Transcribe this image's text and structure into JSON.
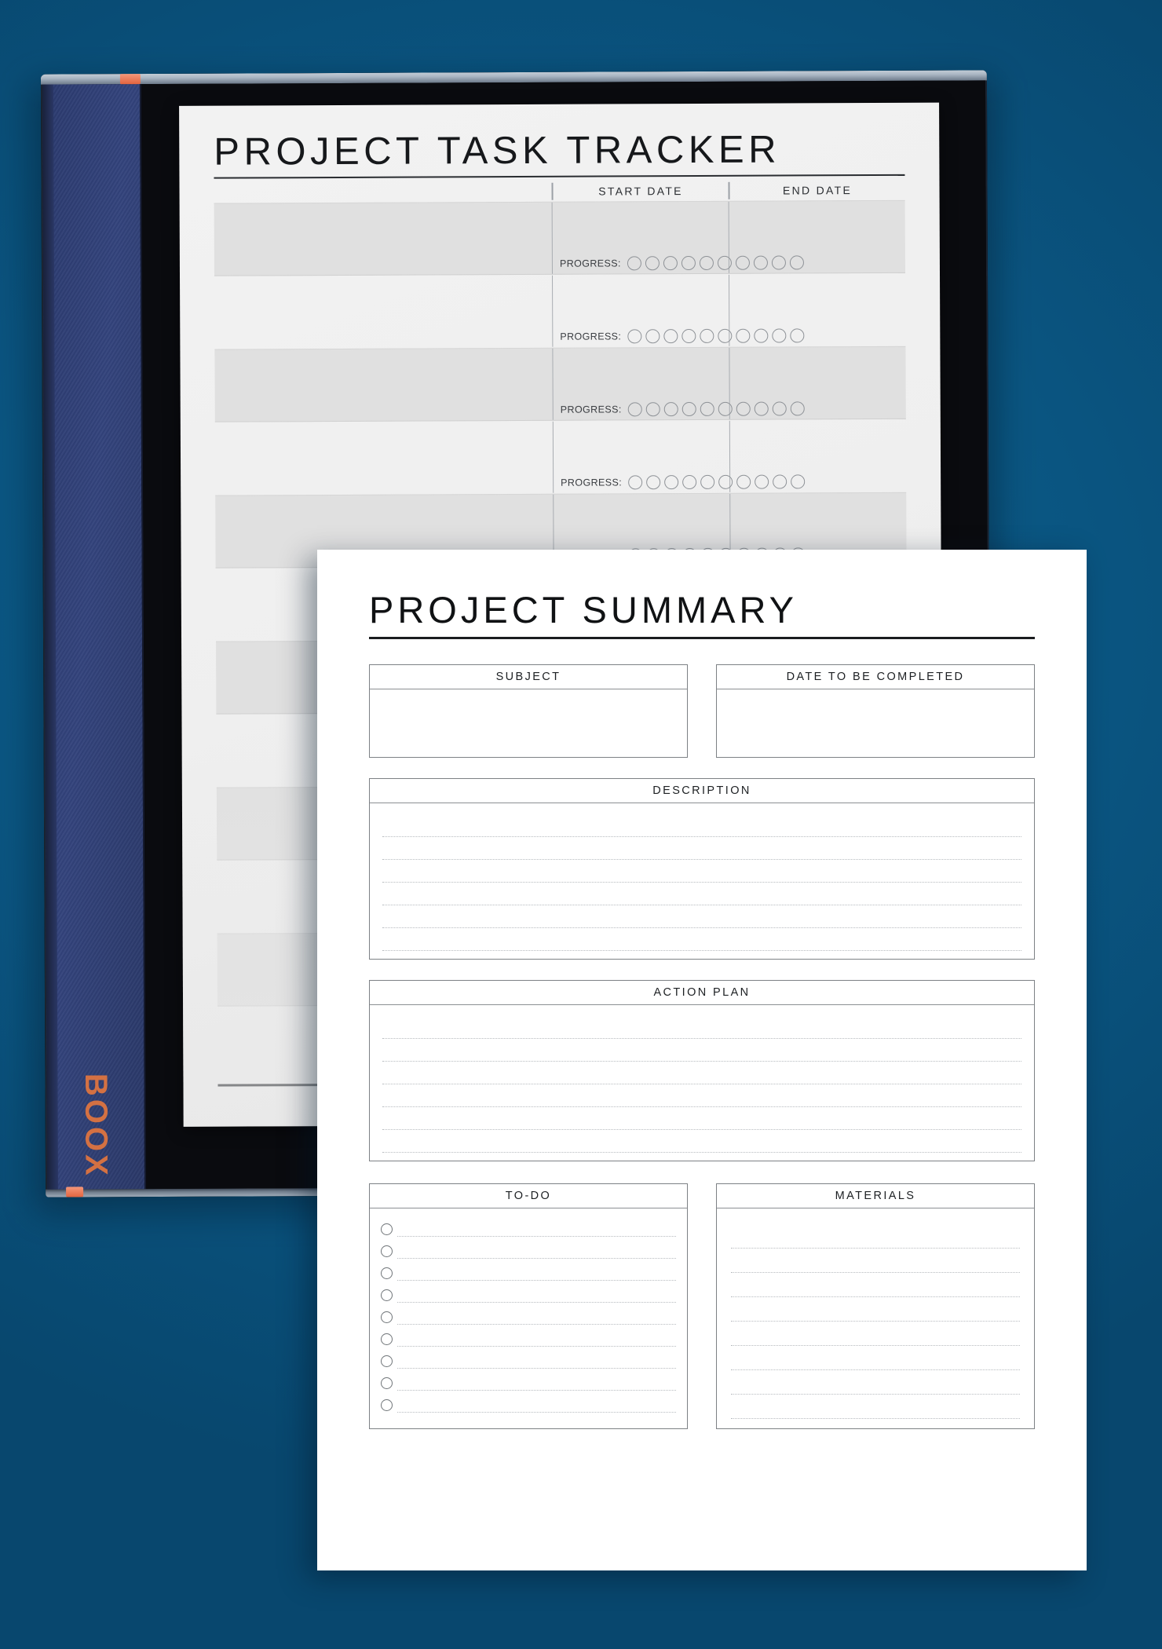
{
  "background": {
    "color": "#0a5581"
  },
  "device": {
    "brand": "BOOX",
    "brand_color": "#e2763f",
    "cover_color": "#2f3e74",
    "bezel_color": "#0a0b0f",
    "accent_color": "#e2643f"
  },
  "tracker": {
    "title": "PROJECT TASK TRACKER",
    "columns": {
      "task": "",
      "start_date": "START DATE",
      "end_date": "END DATE"
    },
    "progress_label": "PROGRESS:",
    "progress_dots": 10,
    "rows": [
      {
        "shaded": true,
        "task": "",
        "start_date": "",
        "end_date": ""
      },
      {
        "shaded": false,
        "task": "",
        "start_date": "",
        "end_date": ""
      },
      {
        "shaded": true,
        "task": "",
        "start_date": "",
        "end_date": ""
      },
      {
        "shaded": false,
        "task": "",
        "start_date": "",
        "end_date": ""
      },
      {
        "shaded": true,
        "task": "",
        "start_date": "",
        "end_date": ""
      },
      {
        "shaded": false,
        "task": "",
        "start_date": "",
        "end_date": ""
      },
      {
        "shaded": true,
        "task": "",
        "start_date": "",
        "end_date": ""
      },
      {
        "shaded": false,
        "task": "",
        "start_date": "",
        "end_date": ""
      },
      {
        "shaded": true,
        "task": "",
        "start_date": "",
        "end_date": ""
      },
      {
        "shaded": false,
        "task": "",
        "start_date": "",
        "end_date": ""
      },
      {
        "shaded": true,
        "task": "",
        "start_date": "",
        "end_date": ""
      },
      {
        "shaded": false,
        "task": "",
        "start_date": "",
        "end_date": ""
      }
    ]
  },
  "summary": {
    "title": "PROJECT SUMMARY",
    "subject": {
      "label": "SUBJECT",
      "value": ""
    },
    "date_to_be_completed": {
      "label": "DATE TO BE COMPLETED",
      "value": ""
    },
    "description": {
      "label": "DESCRIPTION",
      "lines": 6,
      "values": [
        "",
        "",
        "",
        "",
        "",
        ""
      ]
    },
    "action_plan": {
      "label": "ACTION PLAN",
      "lines": 6,
      "values": [
        "",
        "",
        "",
        "",
        "",
        ""
      ]
    },
    "todo": {
      "label": "TO-DO",
      "items": [
        {
          "checked": false,
          "text": ""
        },
        {
          "checked": false,
          "text": ""
        },
        {
          "checked": false,
          "text": ""
        },
        {
          "checked": false,
          "text": ""
        },
        {
          "checked": false,
          "text": ""
        },
        {
          "checked": false,
          "text": ""
        },
        {
          "checked": false,
          "text": ""
        },
        {
          "checked": false,
          "text": ""
        },
        {
          "checked": false,
          "text": ""
        }
      ]
    },
    "materials": {
      "label": "MATERIALS",
      "lines": 8,
      "values": [
        "",
        "",
        "",
        "",
        "",
        "",
        "",
        ""
      ]
    }
  }
}
